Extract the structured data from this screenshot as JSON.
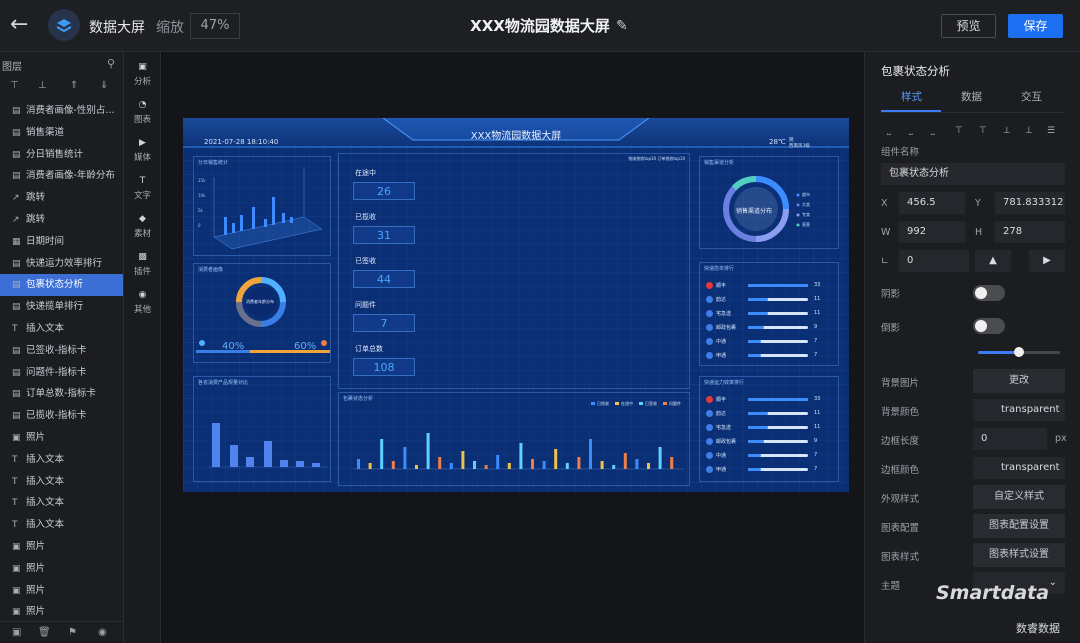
{
  "topbar": {
    "app_name": "数据大屏",
    "zoom_label": "缩放",
    "zoom_value": "47%",
    "title": "XXX物流园数据大屏",
    "preview_label": "预览",
    "save_label": "保存"
  },
  "layers": {
    "header": "图层",
    "items": [
      {
        "icon": "bar-chart-icon",
        "label": "消费者画像-性别占..."
      },
      {
        "icon": "bar-chart-icon",
        "label": "销售渠道"
      },
      {
        "icon": "bar-chart-icon",
        "label": "分日销售统计"
      },
      {
        "icon": "bar-chart-icon",
        "label": "消费者画像-年龄分布"
      },
      {
        "icon": "external-link-icon",
        "label": "跳转"
      },
      {
        "icon": "external-link-icon",
        "label": "跳转"
      },
      {
        "icon": "calendar-icon",
        "label": "日期时间"
      },
      {
        "icon": "bar-chart-icon",
        "label": "快递运力效率排行"
      },
      {
        "icon": "bar-chart-icon",
        "label": "包裹状态分析"
      },
      {
        "icon": "bar-chart-icon",
        "label": "快递揽单排行"
      },
      {
        "icon": "text-icon",
        "label": "插入文本"
      },
      {
        "icon": "bar-chart-icon",
        "label": "已签收-指标卡"
      },
      {
        "icon": "bar-chart-icon",
        "label": "问题件-指标卡"
      },
      {
        "icon": "bar-chart-icon",
        "label": "订单总数-指标卡"
      },
      {
        "icon": "bar-chart-icon",
        "label": "已揽收-指标卡"
      },
      {
        "icon": "image-icon",
        "label": "照片"
      },
      {
        "icon": "text-icon",
        "label": "插入文本"
      },
      {
        "icon": "text-icon",
        "label": "插入文本"
      },
      {
        "icon": "text-icon",
        "label": "插入文本"
      },
      {
        "icon": "text-icon",
        "label": "插入文本"
      },
      {
        "icon": "image-icon",
        "label": "照片"
      },
      {
        "icon": "image-icon",
        "label": "照片"
      },
      {
        "icon": "image-icon",
        "label": "照片"
      },
      {
        "icon": "image-icon",
        "label": "照片"
      }
    ],
    "selected_index": 8
  },
  "components": [
    {
      "icon": "analysis-icon",
      "label": "分析"
    },
    {
      "icon": "chart-icon",
      "label": "图表"
    },
    {
      "icon": "media-icon",
      "label": "媒体"
    },
    {
      "icon": "text-icon",
      "label": "文字"
    },
    {
      "icon": "material-icon",
      "label": "素材"
    },
    {
      "icon": "plugin-icon",
      "label": "插件"
    },
    {
      "icon": "other-icon",
      "label": "其他"
    }
  ],
  "screen": {
    "title": "XXX物流园数据大屏",
    "datetime": "2021-07-28 18:10:40",
    "temperature": "28℃",
    "weather_line1": "阴",
    "weather_line2": "西南风3级",
    "panels": {
      "daily_sales": "分日销售统计",
      "consumer_gender": "消费者画像",
      "gender_donut_label": "消费者年龄分布",
      "gender_female_pct": "40%",
      "gender_male_pct": "60%",
      "category_volume": "各省消费产品规量对比",
      "sales_channel": "销售渠道分析",
      "channel_donut_label": "销售渠道分布",
      "channel_legend": [
        "超市",
        "大卖",
        "专卖",
        "直营"
      ],
      "express_rank": "快递揽单排行",
      "efficiency_rank": "快递运力效率排行",
      "parcel_status": "包裹状态分析",
      "parcel_top_links": "物流揽收top10  订单揽收top10",
      "parcel_legend": [
        "已揽收",
        "在途中",
        "已签收",
        "问题件"
      ]
    },
    "kpis": [
      {
        "label": "在途中",
        "value": "26"
      },
      {
        "label": "已揽收",
        "value": "31"
      },
      {
        "label": "已签收",
        "value": "44"
      },
      {
        "label": "问题件",
        "value": "7"
      },
      {
        "label": "订单总数",
        "value": "108"
      }
    ],
    "express_rank": [
      {
        "name": "顺丰",
        "value": 33
      },
      {
        "name": "韵达",
        "value": 11
      },
      {
        "name": "宅急送",
        "value": 11
      },
      {
        "name": "邮政包裹",
        "value": 9
      },
      {
        "name": "中通",
        "value": 7
      },
      {
        "name": "申通",
        "value": 7
      }
    ],
    "efficiency_rank": [
      {
        "name": "顺丰",
        "value": 33
      },
      {
        "name": "韵达",
        "value": 11
      },
      {
        "name": "宅急送",
        "value": 11
      },
      {
        "name": "邮政包裹",
        "value": 9
      },
      {
        "name": "中通",
        "value": 7
      },
      {
        "name": "申通",
        "value": 7
      }
    ]
  },
  "props": {
    "header": "包裹状态分析",
    "tabs": [
      "样式",
      "数据",
      "交互"
    ],
    "active_tab": 0,
    "component_name_label": "组件名称",
    "component_name": "包裹状态分析",
    "x_label": "X",
    "x": "456.5",
    "y_label": "Y",
    "y": "781.833312",
    "w_label": "W",
    "w": "992",
    "h_label": "H",
    "h": "278",
    "rotation": "0",
    "shadow_label": "阴影",
    "reflection_label": "倒影",
    "reflection_level": 0.5,
    "bg_image_label": "背景图片",
    "bg_image_btn": "更改",
    "bg_color_label": "背景颜色",
    "bg_color": "transparent",
    "border_len_label": "边框长度",
    "border_len": "0",
    "border_len_unit": "px",
    "border_color_label": "边框颜色",
    "border_color": "transparent",
    "appearance_label": "外观样式",
    "appearance_btn": "自定义样式",
    "chart_config_label": "图表配置",
    "chart_config_btn": "图表配置设置",
    "chart_style_label": "图表样式",
    "chart_style_btn": "图表样式设置",
    "theme_label": "主题"
  },
  "watermark": {
    "brand": "Smartdata",
    "sub": "数睿数据"
  },
  "colors": {
    "accent": "#1d6ff2",
    "selected_layer": "#3b6fd6",
    "screen_bg": "#0b2f74",
    "rank_top": "#e23b3b"
  }
}
